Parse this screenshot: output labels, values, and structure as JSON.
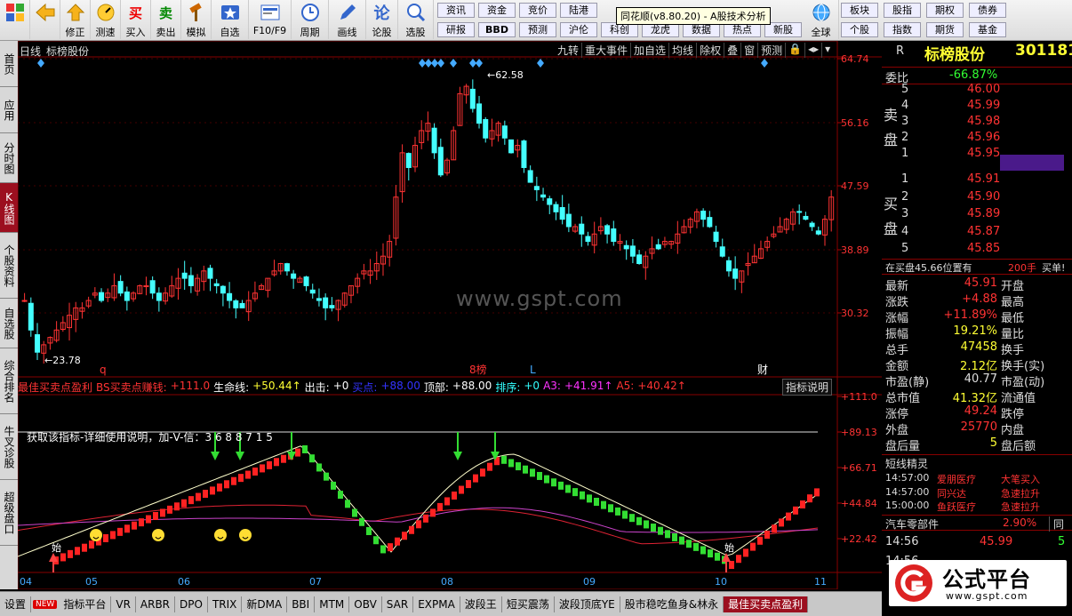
{
  "toolbar": {
    "items": [
      {
        "label": "",
        "icon": "windows-grid-icon"
      },
      {
        "label": "",
        "icon": "back-arrow-icon"
      },
      {
        "label": "修正",
        "icon": "up-arrow-icon"
      },
      {
        "label": "测速",
        "icon": "speed-icon"
      },
      {
        "label": "买入",
        "icon": "buy-icon",
        "glyph": "买"
      },
      {
        "label": "卖出",
        "icon": "sell-icon",
        "glyph": "卖"
      },
      {
        "label": "模拟",
        "icon": "hammer-icon"
      },
      {
        "label": "自选",
        "icon": "star-icon"
      },
      {
        "label": "F10/F9",
        "icon": "f10-icon"
      },
      {
        "label": "周期",
        "icon": "clock-icon"
      },
      {
        "label": "画线",
        "icon": "pencil-icon"
      },
      {
        "label": "论股",
        "icon": "discuss-icon",
        "glyph": "论"
      },
      {
        "label": "选股",
        "icon": "magnifier-icon"
      }
    ],
    "quick_row1": [
      "资讯",
      "资金",
      "竞价",
      "陆港"
    ],
    "quick_row2": [
      "研报",
      "BBD",
      "预测",
      "沪伦",
      "科创",
      "龙虎",
      "数据",
      "热点",
      "新股"
    ],
    "tooltip": "同花顺(v8.80.20) - A股技术分析",
    "right_items": [
      {
        "label": "全球",
        "icon": "globe-icon"
      }
    ],
    "right_row1": [
      "板块",
      "股指",
      "期权",
      "债券"
    ],
    "right_row2": [
      "个股",
      "指数",
      "期货",
      "基金"
    ]
  },
  "sidebar": [
    "首页",
    "应用",
    "分时图",
    "K线图",
    "个股资料",
    "自选股",
    "综合排名",
    "牛叉诊股",
    "超级盘口"
  ],
  "chart": {
    "period": "日线",
    "stock": "标榜股份",
    "buttons": [
      "九转",
      "重大事件",
      "加自选",
      "均线",
      "除权",
      "叠",
      "窗",
      "预测"
    ],
    "price_ticks": [
      "64.74",
      "56.16",
      "47.59",
      "38.89",
      "30.32"
    ],
    "high_label": "62.58",
    "low_label": "23.78",
    "watermark": "www.gspt.com",
    "event_marks": [
      "q",
      "8榜",
      "L",
      "财"
    ],
    "months": [
      "04",
      "05",
      "06",
      "07",
      "08",
      "09",
      "10",
      "11"
    ]
  },
  "indicator": {
    "name": "最佳买卖点盈利",
    "bs": "BS买卖点赚钱:",
    "bs_val": "+111.0",
    "life": "生命线:",
    "life_val": "+50.44↑",
    "out": "出击:",
    "out_val": "+0",
    "buy": "买点:",
    "buy_val": "+88.00",
    "top": "顶部:",
    "top_val": "+88.00",
    "rank": "排序:",
    "rank_val": "+0",
    "a3": "A3:",
    "a3_val": "+41.91↑",
    "a5": "A5:",
    "a5_val": "+40.42↑",
    "explain_btn": "指标说明",
    "notice": "获取该指标-详细使用说明，加-V-信：3 6 8 8 7 1 5",
    "ticks": [
      "+111.0",
      "+89.13",
      "+66.71",
      "+44.84",
      "+22.42"
    ],
    "bottom_label": "始"
  },
  "right": {
    "code_label": "R",
    "stock": "标榜股份",
    "code": "301181",
    "weibi_label": "委比",
    "weibi": "-66.87%",
    "sell_label": "卖盘",
    "buy_label": "买盘",
    "asks": [
      {
        "n": "5",
        "p": "46.00"
      },
      {
        "n": "4",
        "p": "45.99"
      },
      {
        "n": "3",
        "p": "45.98"
      },
      {
        "n": "2",
        "p": "45.96"
      },
      {
        "n": "1",
        "p": "45.95"
      }
    ],
    "bids": [
      {
        "n": "1",
        "p": "45.91"
      },
      {
        "n": "2",
        "p": "45.90"
      },
      {
        "n": "3",
        "p": "45.89"
      },
      {
        "n": "4",
        "p": "45.87"
      },
      {
        "n": "5",
        "p": "45.85"
      }
    ],
    "buy_notice": "在买盘45.66位置有",
    "buy_qty": "200手",
    "buy_tag": "买单!",
    "stats": [
      {
        "l": "最新",
        "v": "45.91",
        "r": "开盘"
      },
      {
        "l": "涨跌",
        "v": "+4.88",
        "r": "最高"
      },
      {
        "l": "涨幅",
        "v": "+11.89%",
        "r": "最低"
      },
      {
        "l": "振幅",
        "v": "19.21%",
        "r": "量比"
      },
      {
        "l": "总手",
        "v": "47458",
        "r": "换手"
      },
      {
        "l": "金额",
        "v": "2.12亿",
        "r": "换手(实)"
      },
      {
        "l": "市盈(静)",
        "v": "40.77",
        "r": "市盈(动)"
      },
      {
        "l": "总市值",
        "v": "41.32亿",
        "r": "流通值"
      },
      {
        "l": "涨停",
        "v": "49.24",
        "r": "跌停"
      },
      {
        "l": "外盘",
        "v": "25770",
        "r": "内盘"
      },
      {
        "l": "盘后量",
        "v": "5",
        "r": "盘后额"
      }
    ],
    "elf_title": "短线精灵",
    "elf": [
      {
        "t": "14:57:00",
        "s": "爱朋医疗",
        "e": "大笔买入"
      },
      {
        "t": "14:57:00",
        "s": "同兴达",
        "e": "急速拉升"
      },
      {
        "t": "15:00:00",
        "s": "鱼跃医疗",
        "e": "急速拉升"
      }
    ],
    "sector": "汽车零部件",
    "sector_pct": "2.90%",
    "sector_next": "同",
    "tick_time": "14:56",
    "tick_price": "45.99",
    "tick_vol": "5",
    "tick2_time": "14:56",
    "logo": "公式平台",
    "logo_url": "www.gspt.com"
  },
  "bottombar": [
    "设置",
    "NEW",
    "指标平台",
    "VR",
    "ARBR",
    "DPO",
    "TRIX",
    "新DMA",
    "BBI",
    "MTM",
    "OBV",
    "SAR",
    "EXPMA",
    "波段王",
    "短买震荡",
    "波段顶底YE",
    "股市稳吃鱼身&林永",
    "最佳买卖点盈利"
  ]
}
